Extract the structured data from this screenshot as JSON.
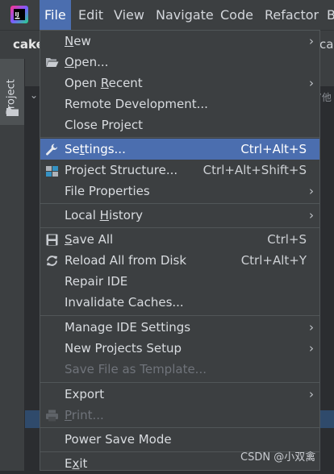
{
  "menubar": {
    "items": [
      {
        "label": "File",
        "active": true
      },
      {
        "label": "Edit"
      },
      {
        "label": "View"
      },
      {
        "label": "Navigate"
      },
      {
        "label": "Code"
      },
      {
        "label": "Refactor"
      },
      {
        "label": "B"
      }
    ]
  },
  "toolbar": {
    "project_name": "cake",
    "right_fragment": "ca"
  },
  "side_panel": {
    "tab_label": "Project"
  },
  "background": {
    "right_text": "’他"
  },
  "file_menu": {
    "items": [
      {
        "label": "New",
        "mnemonic": "N",
        "submenu": true
      },
      {
        "label": "Open...",
        "mnemonic": "O",
        "icon": "folder-open-icon"
      },
      {
        "label": "Open Recent",
        "mnemonic": "R",
        "submenu": true
      },
      {
        "label": "Remote Development..."
      },
      {
        "label": "Close Project"
      },
      {
        "label": "Settings...",
        "mnemonic": "t",
        "shortcut": "Ctrl+Alt+S",
        "icon": "wrench-icon",
        "highlighted": true
      },
      {
        "label": "Project Structure...",
        "shortcut": "Ctrl+Alt+Shift+S",
        "icon": "project-structure-icon"
      },
      {
        "label": "File Properties",
        "submenu": true
      },
      {
        "label": "Local History",
        "mnemonic": "H",
        "submenu": true
      },
      {
        "label": "Save All",
        "mnemonic": "S",
        "shortcut": "Ctrl+S",
        "icon": "save-icon"
      },
      {
        "label": "Reload All from Disk",
        "shortcut": "Ctrl+Alt+Y",
        "icon": "reload-icon"
      },
      {
        "label": "Repair IDE"
      },
      {
        "label": "Invalidate Caches..."
      },
      {
        "label": "Manage IDE Settings",
        "submenu": true
      },
      {
        "label": "New Projects Setup",
        "submenu": true
      },
      {
        "label": "Save File as Template...",
        "disabled": true
      },
      {
        "label": "Export",
        "submenu": true
      },
      {
        "label": "Print...",
        "mnemonic": "P",
        "disabled": true,
        "icon": "printer-icon"
      },
      {
        "label": "Power Save Mode"
      },
      {
        "label": "Exit",
        "mnemonic": "x"
      }
    ]
  },
  "watermark": "CSDN @小双禽",
  "colors": {
    "menubar_bg": "#3c3f41",
    "highlight": "#4b6eaf",
    "menu_bg": "#3c3f41",
    "separator": "#515658",
    "disabled_text": "#6f737a",
    "editor_bg": "#2b2d30"
  }
}
